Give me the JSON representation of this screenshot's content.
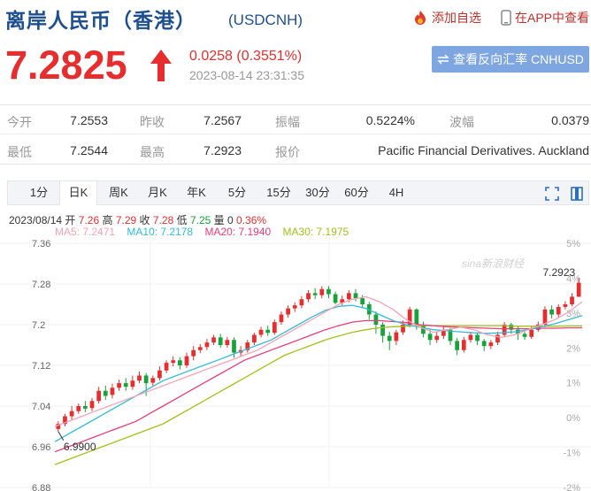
{
  "header": {
    "title": "离岸人民币（香港）",
    "code": "(USDCNH)",
    "add_favorite": "添加自选",
    "view_in_app": "在APP中查看"
  },
  "quote": {
    "price": "7.2825",
    "change": "0.0258 (0.3551%)",
    "datetime": "2023-08-14 23:31:35",
    "reverse_button": "查看反向汇率 CNHUSD"
  },
  "stats": {
    "open_label": "今开",
    "open": "7.2553",
    "prev_close_label": "昨收",
    "prev_close": "7.2567",
    "amplitude_label": "振幅",
    "amplitude": "0.5224%",
    "wave_label": "波幅",
    "wave": "0.0379",
    "low_label": "最低",
    "low": "7.2544",
    "high_label": "最高",
    "high": "7.2923",
    "quote_label": "报价",
    "quote_source": "Pacific Financial Derivatives. Auckland"
  },
  "tabs": [
    "1分",
    "日K",
    "周K",
    "月K",
    "年K",
    "5分",
    "15分",
    "30分",
    "60分",
    "4H"
  ],
  "active_tab": "日K",
  "info": {
    "date": "2023/08/14",
    "open_label": "开",
    "open": "7.26",
    "high_label": "高",
    "high": "7.29",
    "close_label": "收",
    "close": "7.28",
    "low_label": "低",
    "low": "7.25",
    "vol_label": "量",
    "vol": "0",
    "pct": "0.36%"
  },
  "ma": {
    "ma5": "MA5: 7.2471",
    "ma10": "MA10: 7.2178",
    "ma20": "MA20: 7.1940",
    "ma30": "MA30: 7.1975"
  },
  "colors": {
    "up": "#e62e2e",
    "down": "#17a33b",
    "ma5": "#f4a3b5",
    "ma10": "#33bbd6",
    "ma20": "#e83d7a",
    "ma30": "#a2c11a",
    "title_blue": "#1d4f91"
  },
  "chart_data": {
    "type": "candlestick",
    "y_labels": [
      "7.36",
      "7.28",
      "7.2",
      "7.12",
      "7.04",
      "6.96",
      "6.88"
    ],
    "ylim": [
      6.88,
      7.36
    ],
    "pct_labels": [
      "5%",
      "4%",
      "3%",
      "2%",
      "1%",
      "0%",
      "-1%",
      "-2%"
    ],
    "max_label": "7.2923",
    "min_label": "6.9900",
    "watermark": "sina新浪财经",
    "candles": [
      [
        6.995,
        7.005,
        6.99,
        7.01
      ],
      [
        7.005,
        7.02,
        7.0,
        7.025
      ],
      [
        7.02,
        7.03,
        7.012,
        7.04
      ],
      [
        7.03,
        7.04,
        7.025,
        7.045
      ],
      [
        7.04,
        7.035,
        7.028,
        7.05
      ],
      [
        7.036,
        7.05,
        7.03,
        7.056
      ],
      [
        7.05,
        7.07,
        7.045,
        7.078
      ],
      [
        7.07,
        7.06,
        7.052,
        7.08
      ],
      [
        7.062,
        7.076,
        7.055,
        7.084
      ],
      [
        7.076,
        7.085,
        7.07,
        7.092
      ],
      [
        7.085,
        7.078,
        7.07,
        7.095
      ],
      [
        7.078,
        7.09,
        7.072,
        7.1
      ],
      [
        7.09,
        7.1,
        7.085,
        7.108
      ],
      [
        7.1,
        7.085,
        7.06,
        7.105
      ],
      [
        7.086,
        7.095,
        7.08,
        7.1
      ],
      [
        7.095,
        7.11,
        7.09,
        7.118
      ],
      [
        7.11,
        7.125,
        7.105,
        7.13
      ],
      [
        7.125,
        7.13,
        7.118,
        7.138
      ],
      [
        7.13,
        7.12,
        7.112,
        7.136
      ],
      [
        7.12,
        7.138,
        7.115,
        7.145
      ],
      [
        7.138,
        7.15,
        7.13,
        7.158
      ],
      [
        7.15,
        7.156,
        7.144,
        7.162
      ],
      [
        7.156,
        7.165,
        7.15,
        7.172
      ],
      [
        7.165,
        7.175,
        7.16,
        7.18
      ],
      [
        7.175,
        7.16,
        7.155,
        7.182
      ],
      [
        7.16,
        7.17,
        7.155,
        7.176
      ],
      [
        7.17,
        7.145,
        7.135,
        7.175
      ],
      [
        7.145,
        7.15,
        7.138,
        7.158
      ],
      [
        7.15,
        7.165,
        7.145,
        7.17
      ],
      [
        7.165,
        7.18,
        7.16,
        7.184
      ],
      [
        7.18,
        7.19,
        7.175,
        7.196
      ],
      [
        7.19,
        7.184,
        7.178,
        7.198
      ],
      [
        7.184,
        7.205,
        7.18,
        7.21
      ],
      [
        7.205,
        7.22,
        7.2,
        7.226
      ],
      [
        7.22,
        7.232,
        7.214,
        7.238
      ],
      [
        7.232,
        7.238,
        7.225,
        7.244
      ],
      [
        7.238,
        7.25,
        7.232,
        7.256
      ],
      [
        7.25,
        7.262,
        7.244,
        7.268
      ],
      [
        7.262,
        7.258,
        7.25,
        7.272
      ],
      [
        7.258,
        7.27,
        7.252,
        7.276
      ],
      [
        7.27,
        7.26,
        7.252,
        7.276
      ],
      [
        7.26,
        7.243,
        7.24,
        7.265
      ],
      [
        7.243,
        7.25,
        7.238,
        7.257
      ],
      [
        7.25,
        7.262,
        7.244,
        7.268
      ],
      [
        7.262,
        7.252,
        7.246,
        7.27
      ],
      [
        7.252,
        7.24,
        7.232,
        7.258
      ],
      [
        7.24,
        7.22,
        7.21,
        7.245
      ],
      [
        7.22,
        7.2,
        7.182,
        7.226
      ],
      [
        7.2,
        7.178,
        7.165,
        7.205
      ],
      [
        7.178,
        7.168,
        7.15,
        7.186
      ],
      [
        7.168,
        7.185,
        7.16,
        7.19
      ],
      [
        7.185,
        7.2,
        7.18,
        7.208
      ],
      [
        7.2,
        7.23,
        7.195,
        7.235
      ],
      [
        7.23,
        7.2,
        7.19,
        7.232
      ],
      [
        7.2,
        7.182,
        7.175,
        7.206
      ],
      [
        7.182,
        7.17,
        7.16,
        7.19
      ],
      [
        7.17,
        7.178,
        7.164,
        7.186
      ],
      [
        7.178,
        7.19,
        7.172,
        7.196
      ],
      [
        7.19,
        7.168,
        7.16,
        7.194
      ],
      [
        7.168,
        7.15,
        7.14,
        7.174
      ],
      [
        7.15,
        7.17,
        7.145,
        7.176
      ],
      [
        7.17,
        7.18,
        7.165,
        7.186
      ],
      [
        7.18,
        7.168,
        7.16,
        7.184
      ],
      [
        7.168,
        7.158,
        7.148,
        7.172
      ],
      [
        7.158,
        7.165,
        7.152,
        7.17
      ],
      [
        7.165,
        7.18,
        7.16,
        7.186
      ],
      [
        7.18,
        7.2,
        7.175,
        7.205
      ],
      [
        7.2,
        7.19,
        7.182,
        7.204
      ],
      [
        7.19,
        7.182,
        7.17,
        7.196
      ],
      [
        7.182,
        7.176,
        7.17,
        7.19
      ],
      [
        7.176,
        7.19,
        7.172,
        7.196
      ],
      [
        7.19,
        7.2,
        7.186,
        7.206
      ],
      [
        7.2,
        7.23,
        7.195,
        7.236
      ],
      [
        7.23,
        7.22,
        7.212,
        7.238
      ],
      [
        7.22,
        7.235,
        7.214,
        7.24
      ],
      [
        7.235,
        7.24,
        7.23,
        7.246
      ],
      [
        7.24,
        7.255,
        7.236,
        7.262
      ],
      [
        7.255,
        7.2825,
        7.2544,
        7.2923
      ]
    ],
    "ma5": [
      7.0,
      7.01,
      7.02,
      7.03,
      7.04,
      7.05,
      7.06,
      7.07,
      7.08,
      7.09,
      7.1,
      7.11,
      7.12,
      7.13,
      7.14,
      7.15,
      7.165,
      7.18,
      7.195,
      7.21,
      7.225,
      7.24,
      7.25,
      7.255,
      7.245,
      7.23,
      7.21,
      7.195,
      7.185,
      7.19,
      7.195,
      7.19,
      7.18,
      7.175,
      7.18,
      7.19,
      7.2,
      7.21,
      7.225,
      7.245
    ],
    "ma10": [
      6.97,
      6.985,
      7.0,
      7.015,
      7.03,
      7.045,
      7.06,
      7.075,
      7.09,
      7.1,
      7.11,
      7.12,
      7.13,
      7.14,
      7.15,
      7.16,
      7.17,
      7.185,
      7.2,
      7.215,
      7.228,
      7.236,
      7.238,
      7.232,
      7.22,
      7.208,
      7.2,
      7.195,
      7.19,
      7.188,
      7.186,
      7.184,
      7.183,
      7.184,
      7.186,
      7.19,
      7.196,
      7.202,
      7.21,
      7.218
    ],
    "ma20": [
      6.95,
      6.96,
      6.97,
      6.98,
      6.99,
      7.0,
      7.01,
      7.025,
      7.04,
      7.055,
      7.07,
      7.085,
      7.1,
      7.115,
      7.13,
      7.14,
      7.15,
      7.16,
      7.17,
      7.18,
      7.19,
      7.198,
      7.205,
      7.208,
      7.208,
      7.206,
      7.204,
      7.2,
      7.198,
      7.196,
      7.195,
      7.194,
      7.193,
      7.192,
      7.192,
      7.192,
      7.193,
      7.193,
      7.194,
      7.194
    ],
    "ma30": [
      6.925,
      6.935,
      6.945,
      6.955,
      6.965,
      6.975,
      6.985,
      6.995,
      7.005,
      7.02,
      7.035,
      7.05,
      7.065,
      7.08,
      7.095,
      7.11,
      7.125,
      7.14,
      7.15,
      7.16,
      7.17,
      7.178,
      7.185,
      7.19,
      7.194,
      7.196,
      7.197,
      7.198,
      7.198,
      7.198,
      7.198,
      7.198,
      7.198,
      7.198,
      7.197,
      7.197,
      7.197,
      7.197,
      7.1975,
      7.1975
    ]
  }
}
